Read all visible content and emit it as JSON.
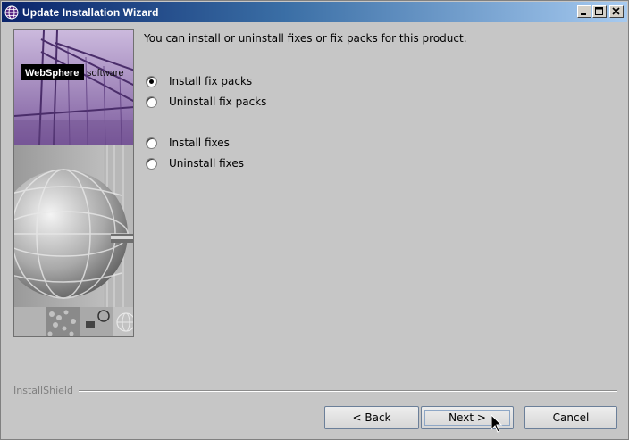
{
  "window": {
    "title": "Update Installation Wizard"
  },
  "side_panel": {
    "brand_word": "WebSphere",
    "brand_suffix": "software"
  },
  "main": {
    "prompt": "You can install or uninstall fixes or fix packs for this product.",
    "options": [
      {
        "label": "Install fix packs",
        "selected": true
      },
      {
        "label": "Uninstall fix packs",
        "selected": false
      },
      {
        "label": "Install fixes",
        "selected": false
      },
      {
        "label": "Uninstall fixes",
        "selected": false
      }
    ]
  },
  "footer": {
    "brand": "InstallShield",
    "back_label": "< Back",
    "next_label": "Next >",
    "cancel_label": "Cancel"
  },
  "colors": {
    "titlebar_start": "#0a246a",
    "titlebar_end": "#a6caf0",
    "window_bg": "#c6c6c6"
  }
}
